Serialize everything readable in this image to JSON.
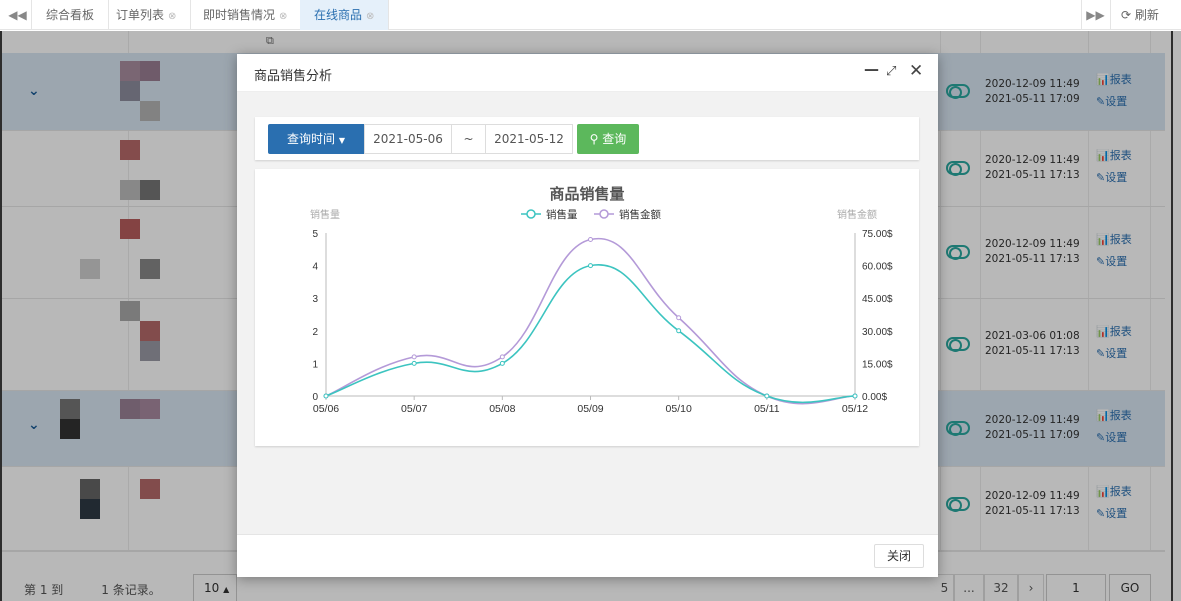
{
  "tabs": [
    {
      "label": "综合看板",
      "closable": false,
      "active": false
    },
    {
      "label": "订单列表",
      "closable": true,
      "active": false
    },
    {
      "label": "即时销售情况",
      "closable": true,
      "active": false
    },
    {
      "label": "在线商品",
      "closable": true,
      "active": true
    }
  ],
  "toolbar": {
    "refresh_label": "刷新"
  },
  "table": {
    "rows": [
      {
        "date1": "2020-12-09 11:49",
        "date2": "2021-05-11 17:09",
        "report": "报表",
        "settings": "设置",
        "selected": true,
        "expandable": true
      },
      {
        "date1": "2020-12-09 11:49",
        "date2": "2021-05-11 17:13",
        "report": "报表",
        "settings": "设置",
        "selected": false,
        "expandable": false
      },
      {
        "date1": "2020-12-09 11:49",
        "date2": "2021-05-11 17:13",
        "report": "报表",
        "settings": "设置",
        "selected": false,
        "expandable": false
      },
      {
        "date1": "2021-03-06 01:08",
        "date2": "2021-05-11 17:13",
        "report": "报表",
        "settings": "设置",
        "selected": false,
        "expandable": false
      },
      {
        "date1": "2020-12-09 11:49",
        "date2": "2021-05-11 17:09",
        "report": "报表",
        "settings": "设置",
        "selected": true,
        "expandable": true
      },
      {
        "date1": "2020-12-09 11:49",
        "date2": "2021-05-11 17:13",
        "report": "报表",
        "settings": "设置",
        "selected": false,
        "expandable": false
      }
    ]
  },
  "pagination": {
    "summary_start": "第 1 到",
    "summary_end": "1 条记录。",
    "page_size": "10",
    "page_partial": "5",
    "ellipsis": "...",
    "last_page": "32",
    "next": "›",
    "goto_value": "1",
    "go_label": "GO"
  },
  "modal": {
    "title": "商品销售分析",
    "query": {
      "time_button": "查询时间",
      "start_date": "2021-05-06",
      "separator": "~",
      "end_date": "2021-05-12",
      "search_button": "查询"
    },
    "close_button": "关闭"
  },
  "chart_data": {
    "type": "line",
    "title": "商品销售量",
    "categories": [
      "05/06",
      "05/07",
      "05/08",
      "05/09",
      "05/10",
      "05/11",
      "05/12"
    ],
    "series": [
      {
        "name": "销售量",
        "axis": "left",
        "color": "#3cc4c0",
        "values": [
          0,
          1,
          1,
          4,
          2,
          0,
          0
        ]
      },
      {
        "name": "销售金额",
        "axis": "right",
        "color": "#b49ad8",
        "values": [
          0,
          18,
          18,
          72,
          36,
          0,
          0
        ]
      }
    ],
    "ylabel_left": "销售量",
    "ylabel_right": "销售金额",
    "ylim_left": [
      0,
      5
    ],
    "ylim_right": [
      0,
      75
    ],
    "yticks_left": [
      "0",
      "1",
      "2",
      "3",
      "4",
      "5"
    ],
    "yticks_right": [
      "0.00$",
      "15.00$",
      "30.00$",
      "45.00$",
      "60.00$",
      "75.00$"
    ],
    "legend": "top-center",
    "smooth": true,
    "grid": false
  }
}
